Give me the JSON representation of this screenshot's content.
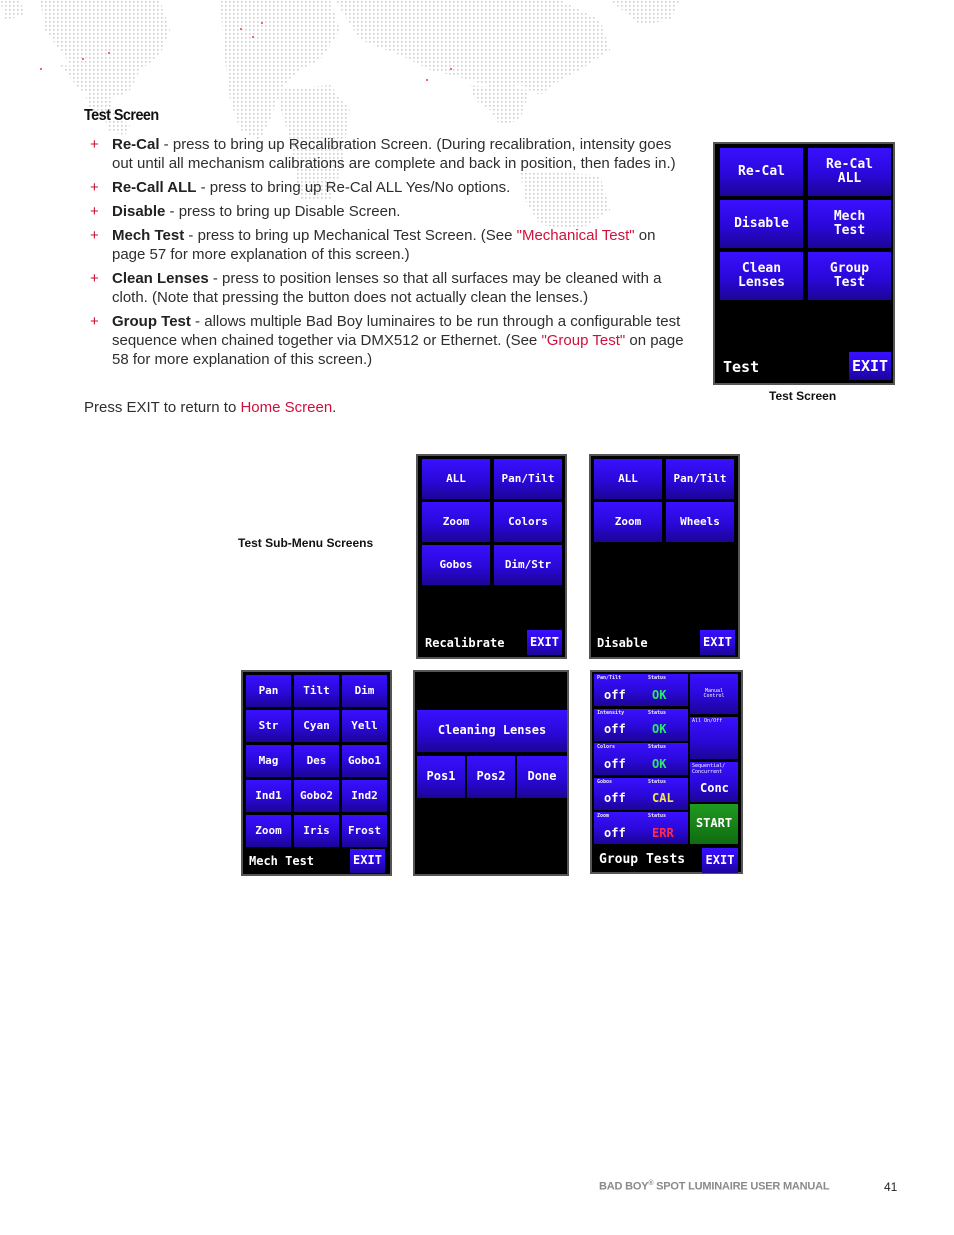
{
  "section": {
    "title": "Test Screen",
    "bullets": [
      {
        "term": "Re-Cal",
        "text": " - press to bring up Recalibration Screen. (During recalibration, intensity goes out until all mechanism calibrations are complete and back in position, then fades in.)"
      },
      {
        "term": "Re-Call ALL",
        "text": " - press to bring up Re-Cal ALL Yes/No options."
      },
      {
        "term": "Disable",
        "text": " - press to bring up Disable Screen."
      },
      {
        "term": "Mech Test",
        "text_before": " - press to bring up Mechanical Test Screen. (See ",
        "link": "\"Mechanical Test\"",
        "text_after": " on page 57 for more explanation of this screen.)"
      },
      {
        "term": "Clean Lenses",
        "text": " - press to position lenses so that all surfaces may be cleaned with a cloth. (Note that pressing the button does not actually clean the lenses.)"
      },
      {
        "term": "Group Test",
        "text_before": " - allows multiple Bad Boy luminaires to be run through a configurable test sequence when chained together via DMX512 or Ethernet. (See ",
        "link": "\"Group Test\"",
        "text_after": " on page 58 for more explanation of this screen.)"
      }
    ],
    "exit_note_before": "Press EXIT to return to ",
    "exit_note_link": "Home Screen",
    "exit_note_after": "."
  },
  "captions": {
    "test_screen": "Test Screen",
    "sub_menu": "Test Sub-Menu Screens"
  },
  "test_screen": {
    "buttons": [
      "Re-Cal",
      "Re-Cal\nALL",
      "Disable",
      "Mech\nTest",
      "Clean\nLenses",
      "Group\nTest"
    ],
    "label": "Test",
    "exit": "EXIT"
  },
  "recalibrate_screen": {
    "buttons": [
      "ALL",
      "Pan/Tilt",
      "Zoom",
      "Colors",
      "Gobos",
      "Dim/Str"
    ],
    "label": "Recalibrate",
    "exit": "EXIT"
  },
  "disable_screen": {
    "buttons": [
      "ALL",
      "Pan/Tilt",
      "Zoom",
      "Wheels"
    ],
    "label": "Disable",
    "exit": "EXIT"
  },
  "mech_test_screen": {
    "buttons": [
      "Pan",
      "Tilt",
      "Dim",
      "Str",
      "Cyan",
      "Yell",
      "Mag",
      "Des",
      "Gobo1",
      "Ind1",
      "Gobo2",
      "Ind2",
      "Zoom",
      "Iris",
      "Frost"
    ],
    "label": "Mech Test",
    "exit": "EXIT"
  },
  "cleaning_screen": {
    "title": "Cleaning Lenses",
    "buttons": [
      "Pos1",
      "Pos2",
      "Done"
    ]
  },
  "group_tests_screen": {
    "rows": [
      {
        "name": "Pan/Tilt",
        "status_label": "Status",
        "value": "off",
        "status": "OK",
        "status_color": "#2ee86a"
      },
      {
        "name": "Intensity",
        "status_label": "Status",
        "value": "off",
        "status": "OK",
        "status_color": "#2ee86a"
      },
      {
        "name": "Colors",
        "status_label": "Status",
        "value": "off",
        "status": "OK",
        "status_color": "#2ee86a"
      },
      {
        "name": "Gobos",
        "status_label": "Status",
        "value": "off",
        "status": "CAL",
        "status_color": "#f2e84a"
      },
      {
        "name": "Zoom",
        "status_label": "Status",
        "value": "off",
        "status": "ERR",
        "status_color": "#ff2a4a"
      }
    ],
    "manual_control": "Manual\nControl",
    "all_on_off": "All On/Off",
    "seq_conc_label": "Sequential/\nConcurrent",
    "seq_conc_value": "Conc",
    "start": "START",
    "label": "Group Tests",
    "exit": "EXIT"
  },
  "footer": {
    "manual_title_a": "BAD BOY",
    "manual_title_reg": "®",
    "manual_title_b": " SPOT LUMINAIRE USER MANUAL",
    "page_number": "41"
  }
}
